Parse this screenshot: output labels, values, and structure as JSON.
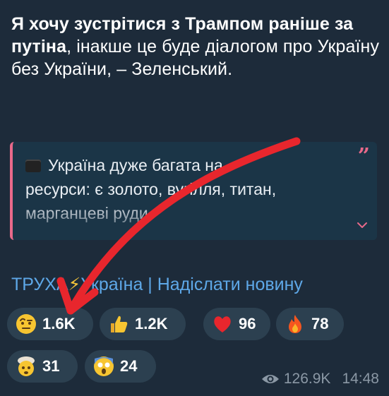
{
  "headline": {
    "bold_part": "Я хочу зустрітися з Трампом раніше за путіна",
    "rest": ", інакше це буде діалогом про Україну без України, – Зеленський."
  },
  "quote": {
    "line1": "Україна дуже багата на",
    "line2": "ресурси: є золото, вугілля, титан,",
    "line3": "марганцеві руди",
    "quote_icon": "quote-mark-icon",
    "expand_icon": "chevron-down-icon"
  },
  "link": {
    "channel_part1": "ТРУХА",
    "bolt": "⚡",
    "channel_part2": "Україна | Надіслати новину"
  },
  "reactions": [
    {
      "emoji": "raised-eyebrow-face-icon",
      "count": "1.6K"
    },
    {
      "emoji": "thumbs-up-icon",
      "count": "1.2K"
    },
    {
      "emoji": "red-heart-icon",
      "count": "96"
    },
    {
      "emoji": "fire-icon",
      "count": "78"
    },
    {
      "emoji": "exploding-head-icon",
      "count": "31"
    },
    {
      "emoji": "screaming-face-icon",
      "count": "24"
    }
  ],
  "meta": {
    "views": "126.9K",
    "time": "14:48"
  },
  "colors": {
    "background": "#1d2b3a",
    "link": "#5ea8e8",
    "quote_accent": "#e8698a",
    "pill": "#2c4050",
    "arrow": "#e8262d"
  }
}
